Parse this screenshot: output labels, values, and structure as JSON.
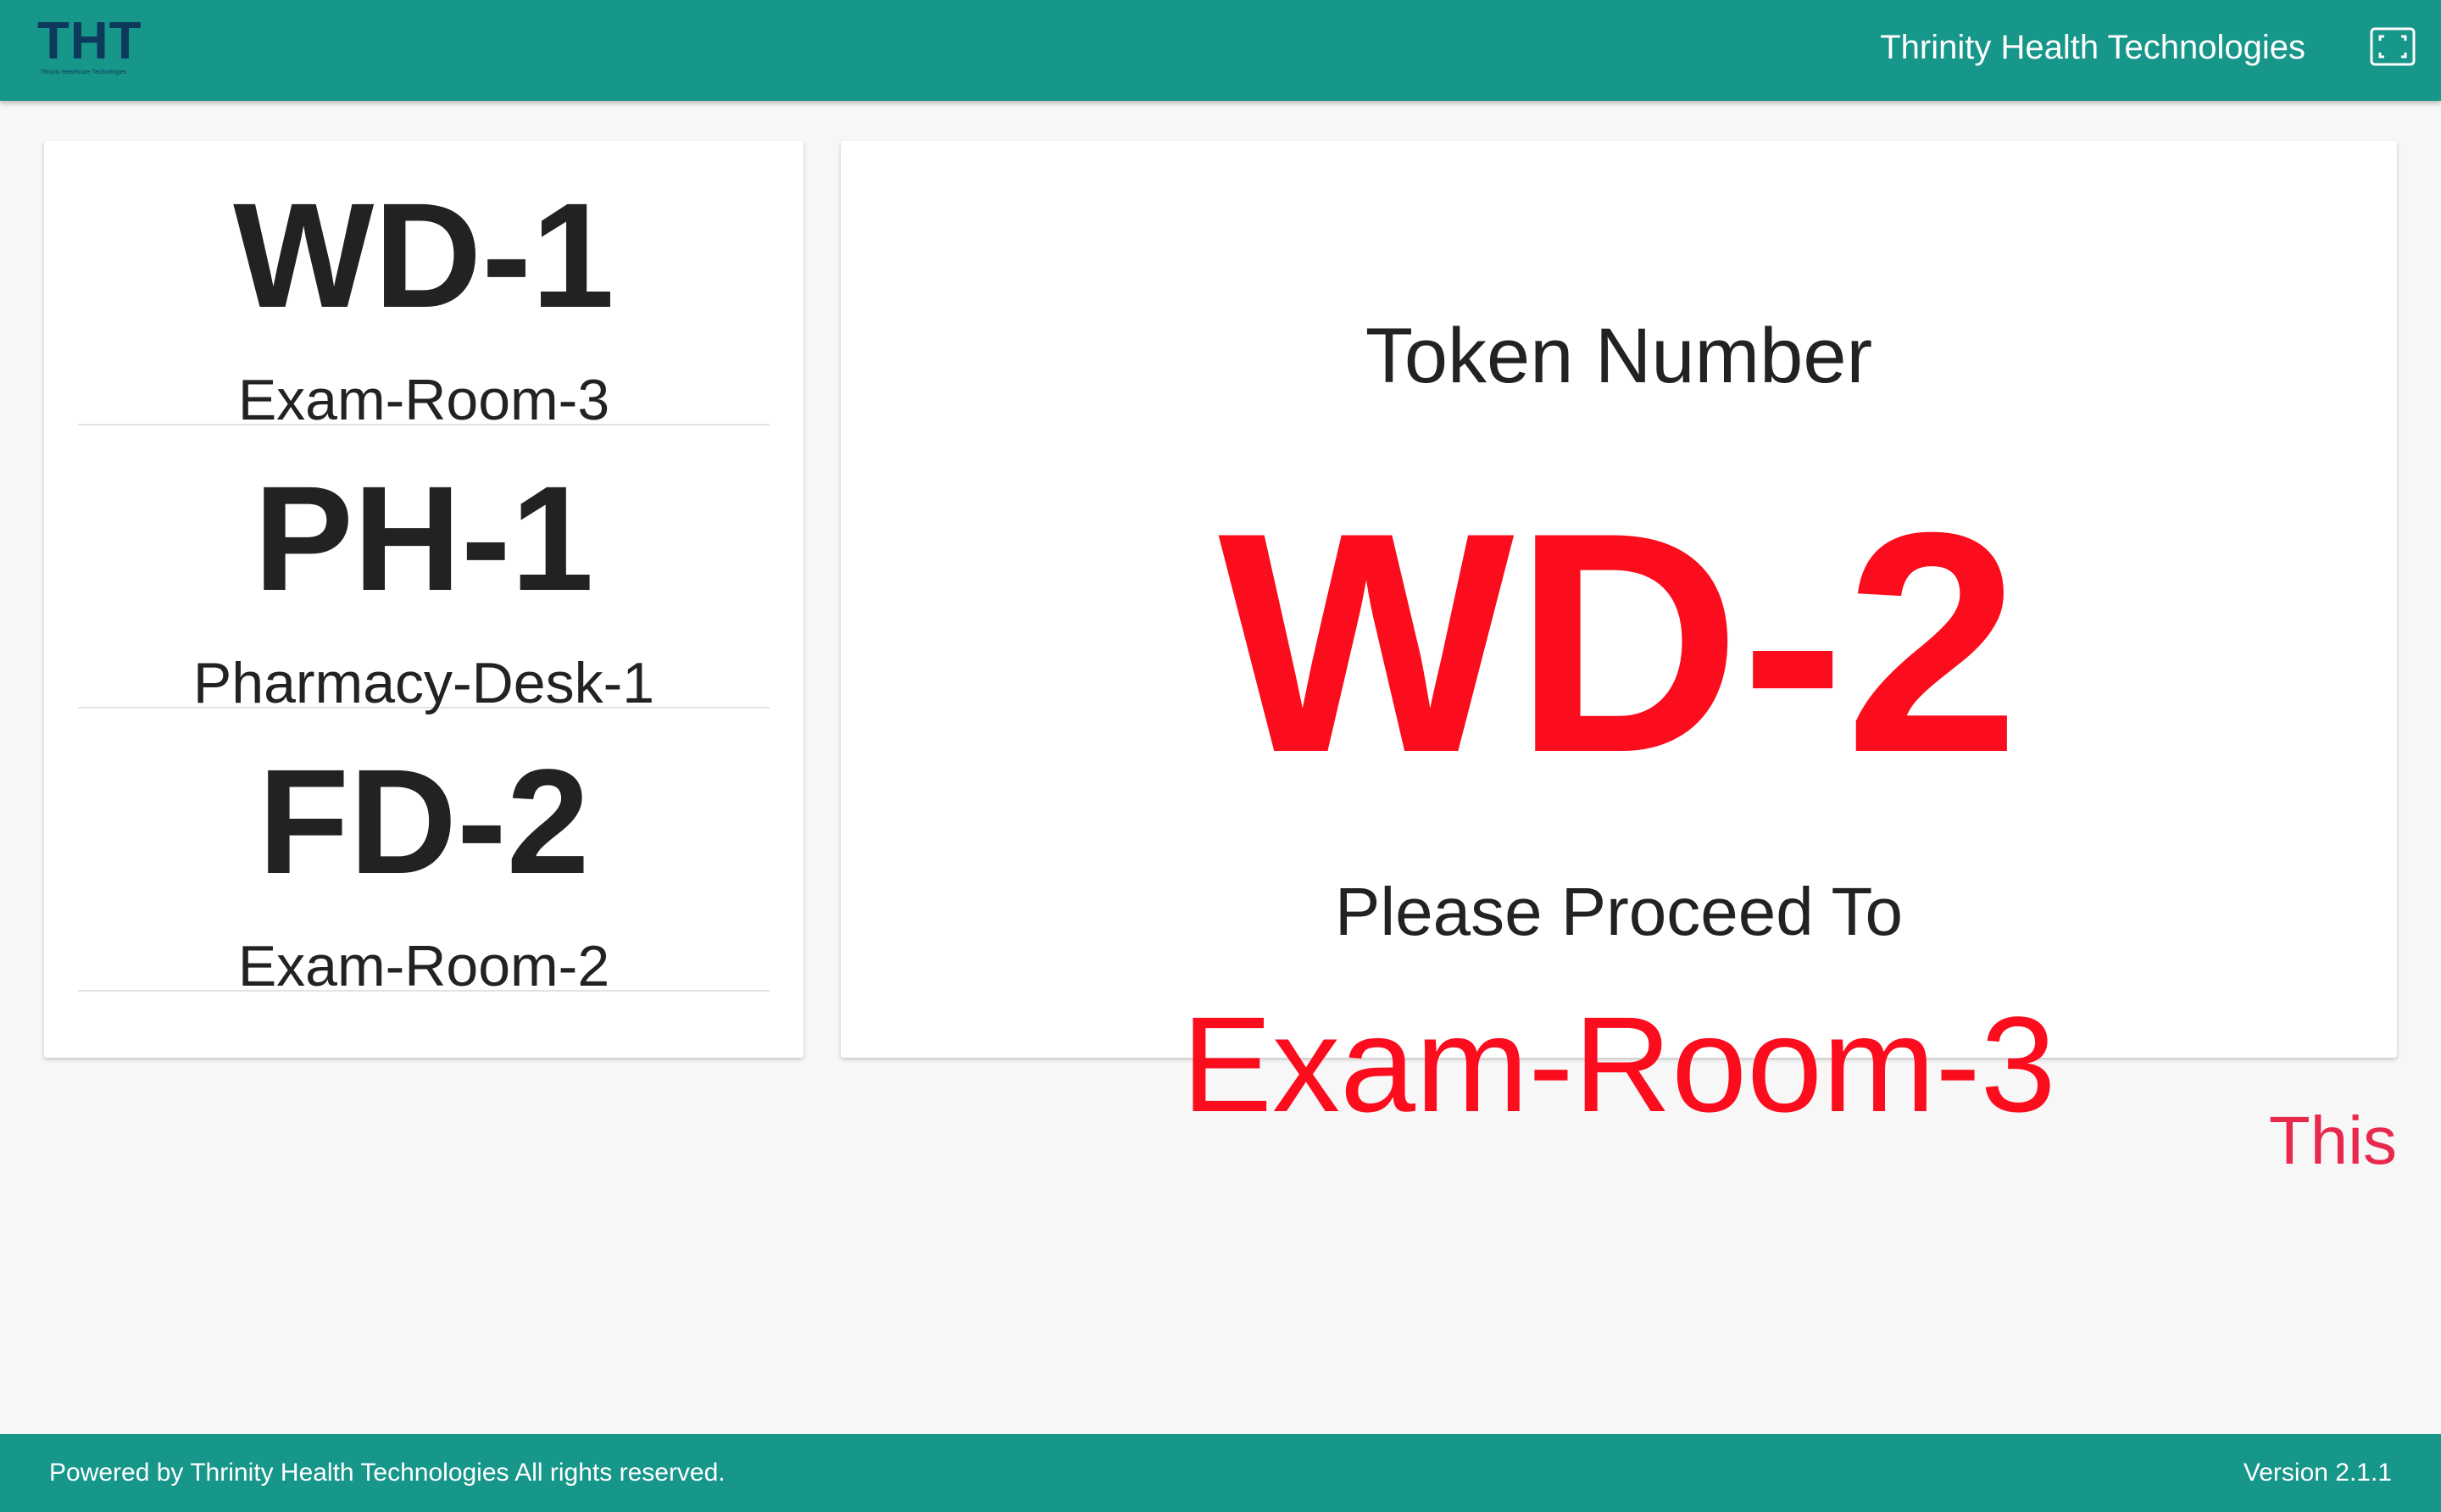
{
  "header": {
    "logo_text": "THT",
    "logo_subtext": "Thrinity Healthcare Technologies",
    "title": "Thrinity Health Technologies",
    "fullscreen_icon": "fullscreen-icon"
  },
  "queue": {
    "items": [
      {
        "token": "WD-1",
        "room": "Exam-Room-3"
      },
      {
        "token": "PH-1",
        "room": "Pharmacy-Desk-1"
      },
      {
        "token": "FD-2",
        "room": "Exam-Room-2"
      }
    ]
  },
  "current": {
    "label": "Token Number",
    "token": "WD-2",
    "proceed_label": "Please Proceed To",
    "destination": "Exam-Room-3"
  },
  "ticker": {
    "text": "This"
  },
  "footer": {
    "powered_by": "Powered by Thrinity Health Technologies All rights reserved.",
    "version": "Version 2.1.1"
  },
  "colors": {
    "primary": "#17968a",
    "alert": "#fb0d1d",
    "ticker": "#e8284d",
    "text": "#222222",
    "background": "#f7f7f7"
  }
}
